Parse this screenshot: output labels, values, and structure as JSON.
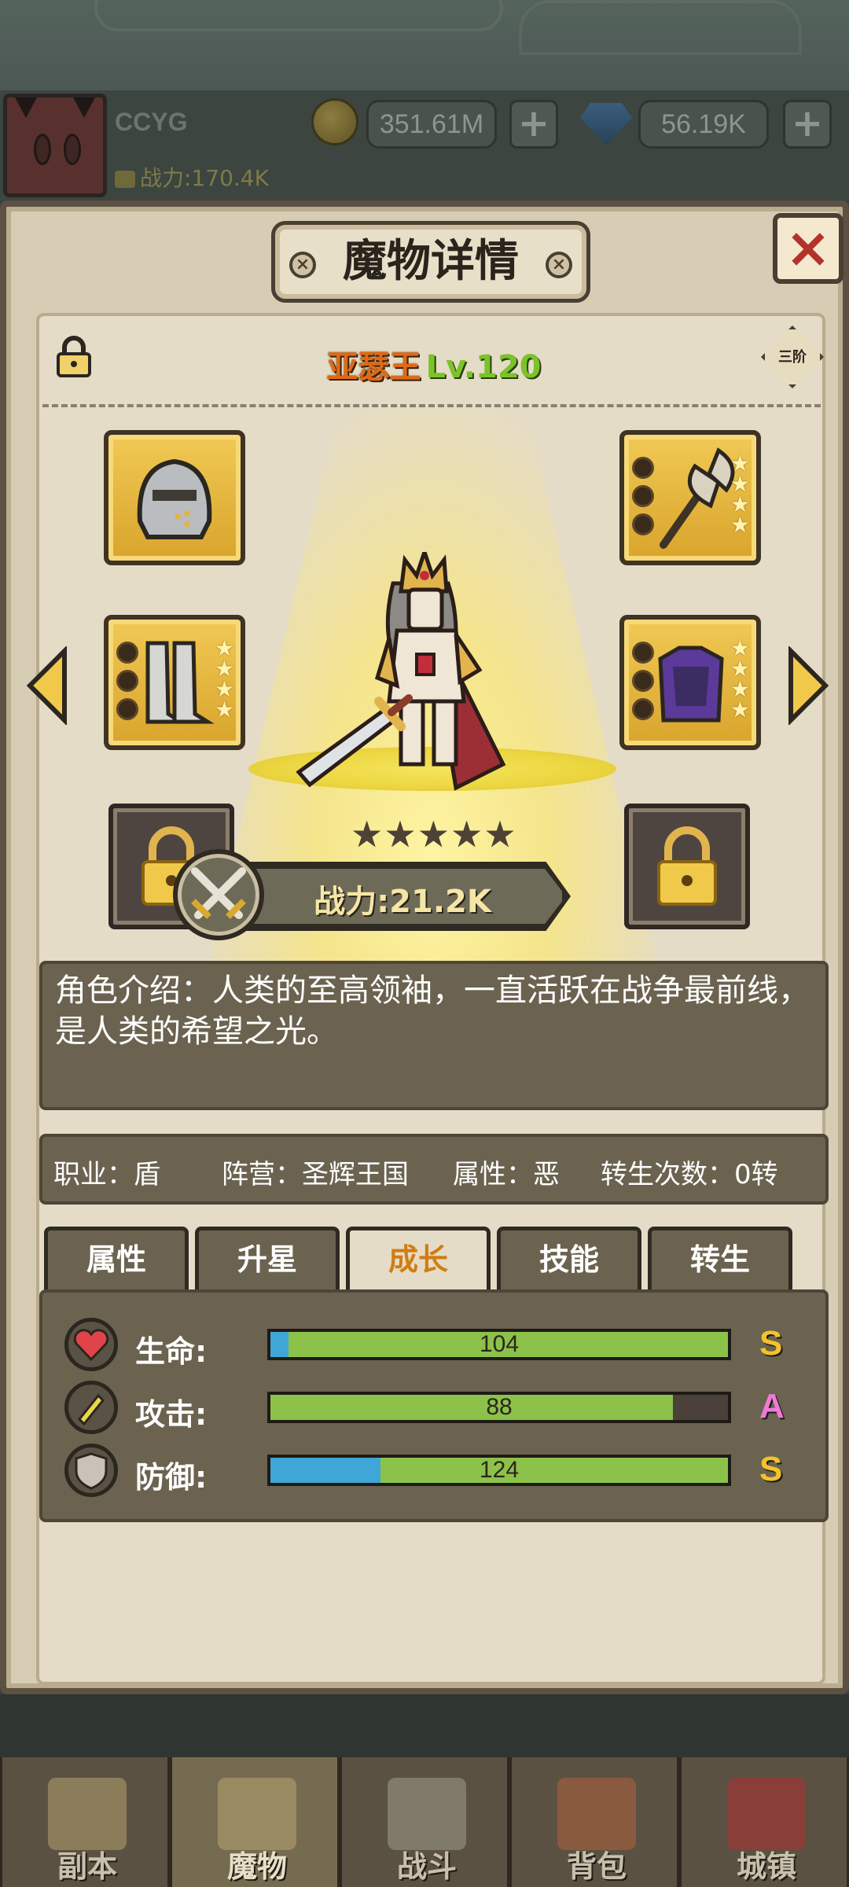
{
  "player": {
    "name": "CCYG",
    "power": "战力:170.4K",
    "gold": "351.61M",
    "gems": "56.19K"
  },
  "dialog": {
    "title": "魔物详情",
    "close_label": "×"
  },
  "hero": {
    "name": "亚瑟王",
    "level": "Lv.120",
    "rank": "三阶",
    "stars": 5,
    "power": "战力:21.2K",
    "description": "角色介绍：人类的至高领袖，一直活跃在战争最前线，是人类的希望之光。"
  },
  "info": {
    "profession": "职业：盾",
    "faction": "阵营：圣辉王国",
    "attribute": "属性：恶",
    "rebirth": "转生次数：0转"
  },
  "tabs": [
    {
      "label": "属性",
      "active": false
    },
    {
      "label": "升星",
      "active": false
    },
    {
      "label": "成长",
      "active": true
    },
    {
      "label": "技能",
      "active": false
    },
    {
      "label": "转生",
      "active": false
    }
  ],
  "stats": [
    {
      "label": "生命:",
      "value": "104",
      "grade": "S",
      "grade_color": "#f3c32a",
      "green_fill": 1.0,
      "blue_fill": 0.04,
      "icon": "heart-icon"
    },
    {
      "label": "攻击:",
      "value": "88",
      "grade": "A",
      "grade_color": "#f07ad8",
      "green_fill": 0.88,
      "blue_fill": 0.0,
      "icon": "sword-icon"
    },
    {
      "label": "防御:",
      "value": "124",
      "grade": "S",
      "grade_color": "#f3c32a",
      "green_fill": 1.0,
      "blue_fill": 0.24,
      "icon": "shield-icon"
    }
  ],
  "equipment": [
    {
      "name": "helmet",
      "stars": 0,
      "sockets": 0
    },
    {
      "name": "axe",
      "stars": 4,
      "sockets": 3
    },
    {
      "name": "greaves",
      "stars": 4,
      "sockets": 3
    },
    {
      "name": "armor",
      "stars": 4,
      "sockets": 3
    }
  ],
  "nav": [
    {
      "label": "副本",
      "active": false
    },
    {
      "label": "魔物",
      "active": true
    },
    {
      "label": "战斗",
      "active": false
    },
    {
      "label": "背包",
      "active": false
    },
    {
      "label": "城镇",
      "active": false
    }
  ],
  "colors": {
    "accent": "#d27c14",
    "hero_name": "#e06a14",
    "level": "#7cc22a",
    "bar_green": "#8cc24a",
    "bar_blue": "#3fa6d8"
  }
}
